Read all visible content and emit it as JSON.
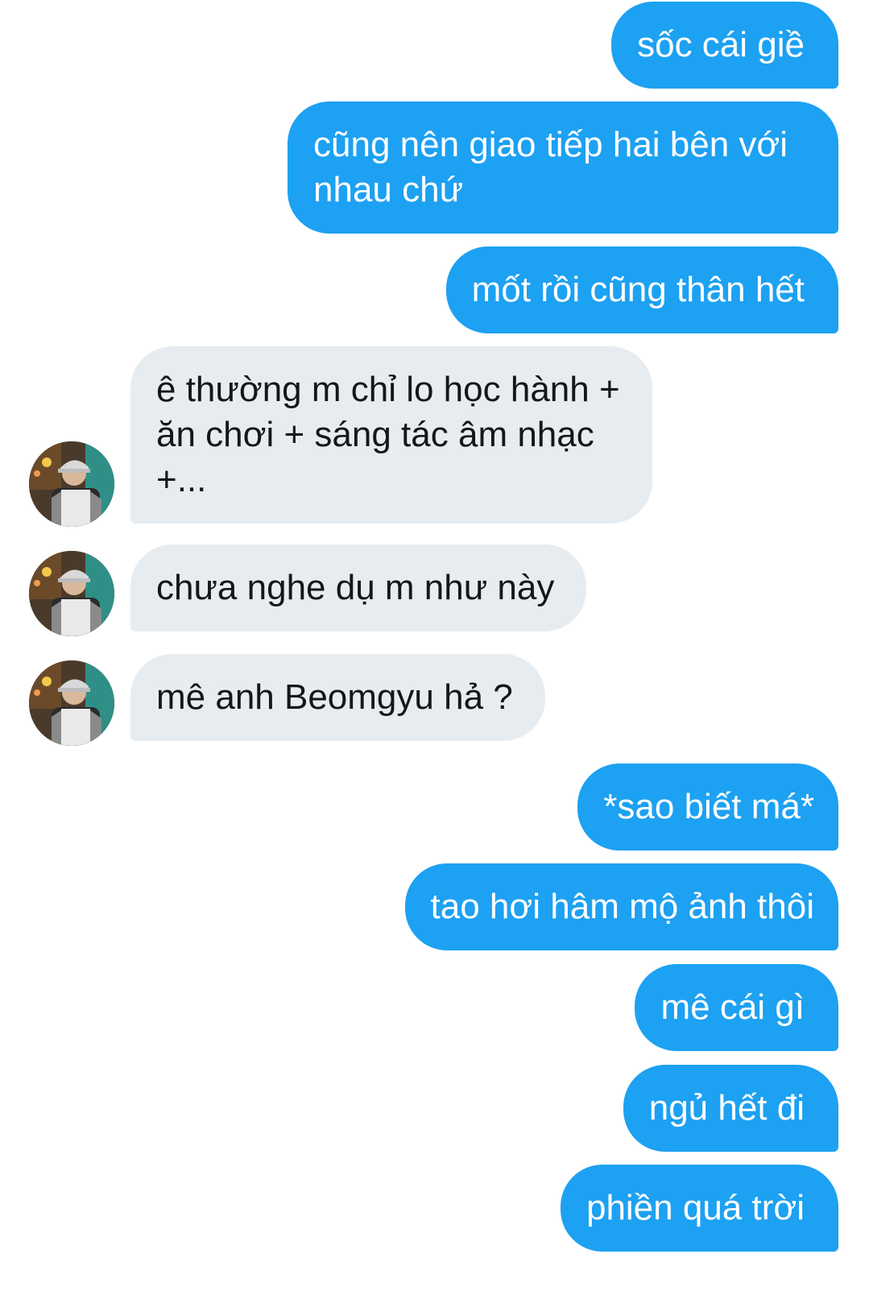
{
  "conversation": {
    "messages": [
      {
        "direction": "outgoing",
        "text": "sốc cái giề"
      },
      {
        "direction": "outgoing",
        "line1": "cũng nên giao tiếp hai bên với",
        "line2": "nhau chứ"
      },
      {
        "direction": "outgoing",
        "text": "mốt rồi cũng thân hết"
      },
      {
        "direction": "incoming",
        "line1": "ê thường m chỉ lo học hành +",
        "line2": "ăn chơi + sáng tác âm nhạc",
        "line3": "+..."
      },
      {
        "direction": "incoming",
        "text": "chưa nghe dụ m như này"
      },
      {
        "direction": "incoming",
        "text": "mê anh Beomgyu hả ?"
      },
      {
        "direction": "outgoing",
        "text": "*sao biết má*"
      },
      {
        "direction": "outgoing",
        "text": "tao hơi hâm mộ ảnh thôi"
      },
      {
        "direction": "outgoing",
        "text": "mê cái gì"
      },
      {
        "direction": "outgoing",
        "text": "ngủ hết đi"
      },
      {
        "direction": "outgoing",
        "text": "phiền quá trời"
      }
    ]
  },
  "colors": {
    "outgoing_bubble": "#1da1f2",
    "incoming_bubble": "#e6ecf0",
    "outgoing_text": "#ffffff",
    "incoming_text": "#14171a"
  },
  "icons": {
    "avatar": "profile-photo-avatar"
  }
}
